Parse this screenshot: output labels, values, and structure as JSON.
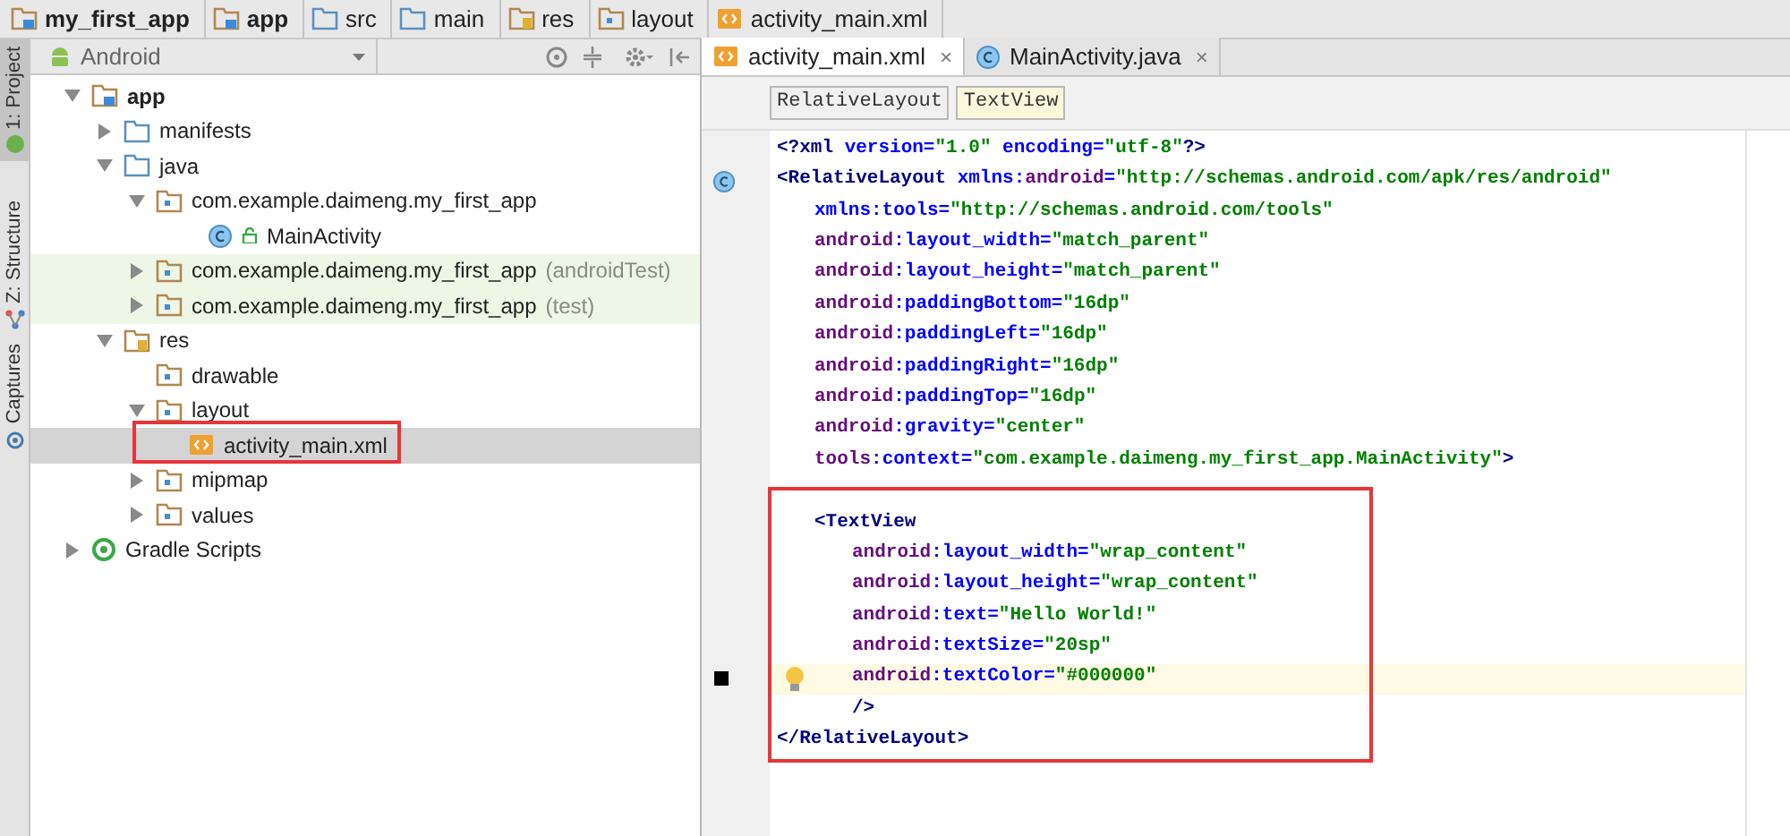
{
  "breadcrumbs": [
    {
      "label": "my_first_app",
      "kind": "module",
      "bold": true
    },
    {
      "label": "app",
      "kind": "module",
      "bold": true
    },
    {
      "label": "src",
      "kind": "folder",
      "bold": false
    },
    {
      "label": "main",
      "kind": "folder",
      "bold": false
    },
    {
      "label": "res",
      "kind": "res",
      "bold": false
    },
    {
      "label": "layout",
      "kind": "package",
      "bold": false
    },
    {
      "label": "activity_main.xml",
      "kind": "xml",
      "bold": false
    }
  ],
  "tool_strip": [
    {
      "label": "1: Project",
      "selected": true,
      "kind": "android"
    },
    {
      "label": "Z: Structure",
      "selected": false,
      "kind": "structure"
    },
    {
      "label": "Captures",
      "selected": false,
      "kind": "captures"
    }
  ],
  "project_panel": {
    "view": "Android"
  },
  "tree": [
    {
      "label": "app",
      "kind": "module",
      "expanded": true,
      "selected": false,
      "children": [
        {
          "label": "manifests",
          "kind": "folder",
          "expanded": false,
          "selected": false
        },
        {
          "label": "java",
          "kind": "folder",
          "expanded": true,
          "selected": false,
          "children": [
            {
              "label": "com.example.daimeng.my_first_app",
              "kind": "package",
              "expanded": true,
              "selected": false,
              "children": [
                {
                  "label": "MainActivity",
                  "kind": "class",
                  "selected": false
                }
              ]
            },
            {
              "label": "com.example.daimeng.my_first_app",
              "suffix": "(androidTest)",
              "kind": "package",
              "expanded": false,
              "selected": false,
              "tinted": true
            },
            {
              "label": "com.example.daimeng.my_first_app",
              "suffix": "(test)",
              "kind": "package",
              "expanded": false,
              "selected": false,
              "tinted": true
            }
          ]
        },
        {
          "label": "res",
          "kind": "res",
          "expanded": true,
          "selected": false,
          "children": [
            {
              "label": "drawable",
              "kind": "package",
              "selected": false
            },
            {
              "label": "layout",
              "kind": "package",
              "expanded": true,
              "selected": false,
              "children": [
                {
                  "label": "activity_main.xml",
                  "kind": "xml",
                  "selected": true
                }
              ]
            },
            {
              "label": "mipmap",
              "kind": "package",
              "expanded": false,
              "selected": false
            },
            {
              "label": "values",
              "kind": "package",
              "expanded": false,
              "selected": false
            }
          ]
        }
      ]
    },
    {
      "label": "Gradle Scripts",
      "kind": "gradle",
      "expanded": false,
      "selected": false
    }
  ],
  "editor_tabs": [
    {
      "label": "activity_main.xml",
      "kind": "xml",
      "selected": true,
      "close": "×"
    },
    {
      "label": "MainActivity.java",
      "kind": "class",
      "selected": false,
      "close": "×"
    }
  ],
  "tag_path": [
    {
      "label": "RelativeLayout",
      "selected": false
    },
    {
      "label": "TextView",
      "selected": true
    }
  ],
  "code": [
    {
      "kind": "root",
      "segments": [
        {
          "kind": "tag",
          "text": "<?xml "
        },
        {
          "kind": "attr",
          "text": "version="
        },
        {
          "kind": "value",
          "text": "\"1.0\" "
        },
        {
          "kind": "attr",
          "text": "encoding="
        },
        {
          "kind": "value",
          "text": "\"utf-8\""
        },
        {
          "kind": "tag",
          "text": "?>"
        }
      ]
    },
    {
      "kind": "root",
      "class_marker": true,
      "segments": [
        {
          "kind": "tag",
          "text": "<RelativeLayout "
        },
        {
          "kind": "attr",
          "text": "xmlns:"
        },
        {
          "kind": "ns",
          "text": "android"
        },
        {
          "kind": "attr",
          "text": "="
        },
        {
          "kind": "value",
          "text": "\"http://schemas.android.com/apk/res/android\""
        }
      ]
    },
    {
      "kind": "attribute",
      "segments": [
        {
          "kind": "attr",
          "text": "xmlns:tools="
        },
        {
          "kind": "value",
          "text": "\"http://schemas.android.com/tools\""
        }
      ]
    },
    {
      "kind": "attribute",
      "segments": [
        {
          "kind": "ns",
          "text": "android"
        },
        {
          "kind": "attr",
          "text": ":layout_width="
        },
        {
          "kind": "value",
          "text": "\"match_parent\""
        }
      ]
    },
    {
      "kind": "attribute",
      "segments": [
        {
          "kind": "ns",
          "text": "android"
        },
        {
          "kind": "attr",
          "text": ":layout_height="
        },
        {
          "kind": "value",
          "text": "\"match_parent\""
        }
      ]
    },
    {
      "kind": "attribute",
      "segments": [
        {
          "kind": "ns",
          "text": "android"
        },
        {
          "kind": "attr",
          "text": ":paddingBottom="
        },
        {
          "kind": "value",
          "text": "\"16dp\""
        }
      ]
    },
    {
      "kind": "attribute",
      "segments": [
        {
          "kind": "ns",
          "text": "android"
        },
        {
          "kind": "attr",
          "text": ":paddingLeft="
        },
        {
          "kind": "value",
          "text": "\"16dp\""
        }
      ]
    },
    {
      "kind": "attribute",
      "segments": [
        {
          "kind": "ns",
          "text": "android"
        },
        {
          "kind": "attr",
          "text": ":paddingRight="
        },
        {
          "kind": "value",
          "text": "\"16dp\""
        }
      ]
    },
    {
      "kind": "attribute",
      "segments": [
        {
          "kind": "ns",
          "text": "android"
        },
        {
          "kind": "attr",
          "text": ":paddingTop="
        },
        {
          "kind": "value",
          "text": "\"16dp\""
        }
      ]
    },
    {
      "kind": "attribute",
      "segments": [
        {
          "kind": "ns",
          "text": "android"
        },
        {
          "kind": "attr",
          "text": ":gravity="
        },
        {
          "kind": "value",
          "text": "\"center\""
        }
      ]
    },
    {
      "kind": "attribute",
      "segments": [
        {
          "kind": "ns",
          "text": "tools"
        },
        {
          "kind": "attr",
          "text": ":context="
        },
        {
          "kind": "value",
          "text": "\"com.example.daimeng.my_first_app.MainActivity\""
        },
        {
          "kind": "tag",
          "text": ">"
        }
      ]
    },
    {
      "kind": "blank"
    },
    {
      "kind": "child",
      "segments": [
        {
          "kind": "tag",
          "text": "<TextView"
        }
      ]
    },
    {
      "kind": "child_attribute",
      "segments": [
        {
          "kind": "ns",
          "text": "android"
        },
        {
          "kind": "attr",
          "text": ":layout_width="
        },
        {
          "kind": "value",
          "text": "\"wrap_content\""
        }
      ]
    },
    {
      "kind": "child_attribute",
      "segments": [
        {
          "kind": "ns",
          "text": "android"
        },
        {
          "kind": "attr",
          "text": ":layout_height="
        },
        {
          "kind": "value",
          "text": "\"wrap_content\""
        }
      ]
    },
    {
      "kind": "child_attribute",
      "segments": [
        {
          "kind": "ns",
          "text": "android"
        },
        {
          "kind": "attr",
          "text": ":text="
        },
        {
          "kind": "value",
          "text": "\"Hello World!\""
        }
      ]
    },
    {
      "kind": "child_attribute",
      "segments": [
        {
          "kind": "ns",
          "text": "android"
        },
        {
          "kind": "attr",
          "text": ":textSize="
        },
        {
          "kind": "value",
          "text": "\"20sp\""
        }
      ]
    },
    {
      "kind": "child_attribute",
      "bookmark": true,
      "hint": true,
      "current": true,
      "segments": [
        {
          "kind": "ns",
          "text": "android"
        },
        {
          "kind": "attr",
          "text": ":textColor="
        },
        {
          "kind": "value",
          "text": "\"#000000\""
        }
      ]
    },
    {
      "kind": "child_attribute",
      "segments": [
        {
          "kind": "tag",
          "text": "/>"
        }
      ]
    },
    {
      "kind": "root",
      "segments": [
        {
          "kind": "tag",
          "text": "</RelativeLayout>"
        }
      ]
    }
  ]
}
